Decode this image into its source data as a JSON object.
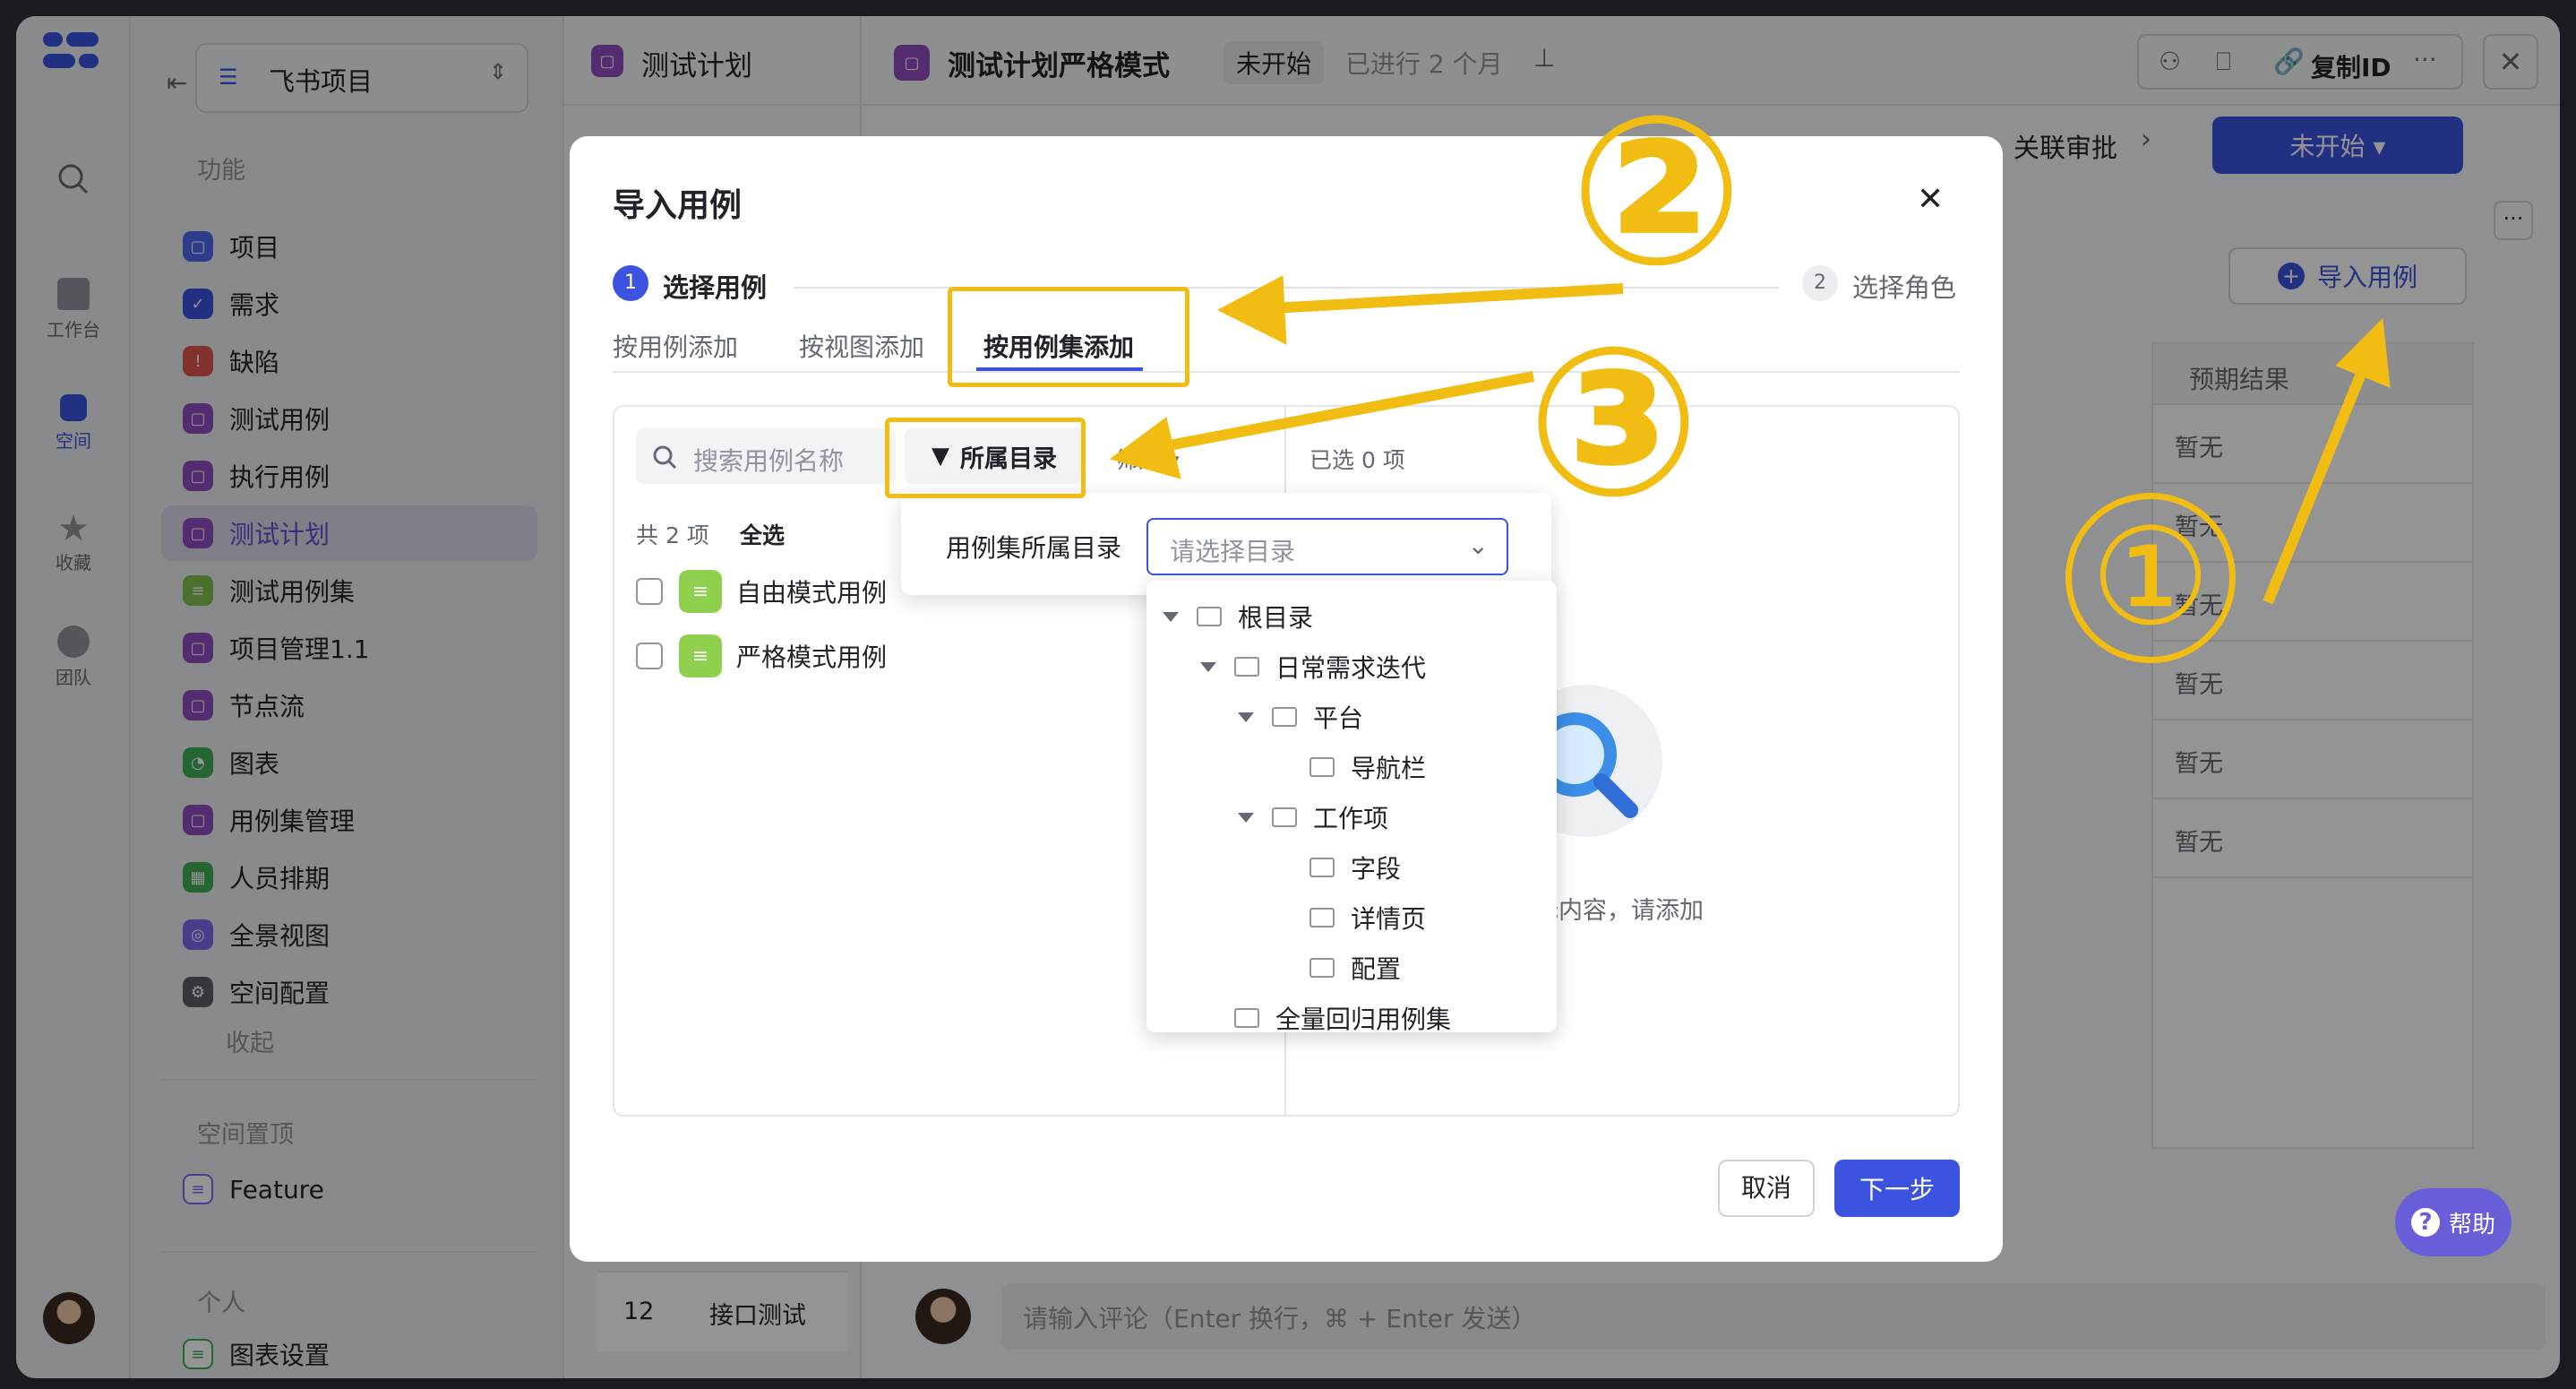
{
  "colors": {
    "accent": "#3c53e0",
    "annotation": "#f2bd12",
    "purple": "#8f4fbf",
    "green": "#8fd14f"
  },
  "rail": {
    "items": [
      {
        "label": "",
        "icon": "search-icon"
      },
      {
        "label": "工作台",
        "icon": "home-icon"
      },
      {
        "label": "空间",
        "icon": "space-icon"
      },
      {
        "label": "收藏",
        "icon": "star-icon"
      },
      {
        "label": "团队",
        "icon": "team-icon"
      }
    ]
  },
  "sidebar": {
    "project_name": "飞书项目",
    "section_func": "功能",
    "items": [
      {
        "label": "项目",
        "color": "#4e6af2",
        "icon": "▢"
      },
      {
        "label": "需求",
        "color": "#3c53e0",
        "icon": "✓"
      },
      {
        "label": "缺陷",
        "color": "#e0574f",
        "icon": "!"
      },
      {
        "label": "测试用例",
        "color": "#8f4fbf",
        "icon": "▢"
      },
      {
        "label": "执行用例",
        "color": "#8f4fbf",
        "icon": "▢"
      },
      {
        "label": "测试计划",
        "color": "#8f4fbf",
        "icon": "▢"
      },
      {
        "label": "测试用例集",
        "color": "#7ec24f",
        "icon": "≡"
      },
      {
        "label": "项目管理1.1",
        "color": "#8f4fbf",
        "icon": "▢"
      },
      {
        "label": "节点流",
        "color": "#8f4fbf",
        "icon": "▢"
      },
      {
        "label": "图表",
        "color": "#3fae55",
        "icon": "◔"
      },
      {
        "label": "用例集管理",
        "color": "#8f4fbf",
        "icon": "▢"
      },
      {
        "label": "人员排期",
        "color": "#3fae55",
        "icon": "▦"
      },
      {
        "label": "全景视图",
        "color": "#7a6cf0",
        "icon": "◎"
      },
      {
        "label": "空间配置",
        "color": "#5b5f66",
        "icon": "⚙"
      }
    ],
    "collapse": "收起",
    "section_pinned": "空间置顶",
    "pinned_item": "Feature",
    "section_personal": "个人",
    "personal_item": "图表设置"
  },
  "listpane": {
    "title": "测试计划",
    "row_num": "12",
    "row_label": "接口测试"
  },
  "header": {
    "title": "测试计划严格模式",
    "status_tag": "未开始",
    "duration": "已进行 2 个月",
    "copy_id": "复制ID",
    "tab_partial": "关联审批",
    "status_button": "未开始 ▾",
    "import_button": "导入用例",
    "column_header": "预期结果",
    "cells": [
      "暂无",
      "暂无",
      "暂无",
      "暂无",
      "暂无",
      "暂无"
    ],
    "comment_placeholder": "请输入评论（Enter 换行，⌘ + Enter 发送）",
    "help": "帮助"
  },
  "modal": {
    "title": "导入用例",
    "step1_num": "1",
    "step1_label": "选择用例",
    "step2_num": "2",
    "step2_label": "选择角色",
    "tabs": [
      "按用例添加",
      "按视图添加",
      "按用例集添加"
    ],
    "search_placeholder": "搜索用例名称",
    "filter_label": "所属目录",
    "filter2_label": "筛选",
    "selected_count": "已选 0 项",
    "total": "共 2 项",
    "select_all": "全选",
    "cases": [
      "自由模式用例",
      "严格模式用例"
    ],
    "empty_text": "暂无内容，请添加",
    "popover_label": "用例集所属目录",
    "popover_placeholder": "请选择目录",
    "tree": [
      {
        "label": "根目录",
        "level": 0,
        "caret": true
      },
      {
        "label": "日常需求迭代",
        "level": 1,
        "caret": true
      },
      {
        "label": "平台",
        "level": 2,
        "caret": true
      },
      {
        "label": "导航栏",
        "level": 3,
        "caret": false
      },
      {
        "label": "工作项",
        "level": 2,
        "caret": true
      },
      {
        "label": "字段",
        "level": 3,
        "caret": false
      },
      {
        "label": "详情页",
        "level": 3,
        "caret": false
      },
      {
        "label": "配置",
        "level": 3,
        "caret": false
      },
      {
        "label": "全量回归用例集",
        "level": 1,
        "caret": false
      }
    ],
    "cancel": "取消",
    "next": "下一步"
  },
  "annotations": [
    "①",
    "②",
    "③"
  ]
}
